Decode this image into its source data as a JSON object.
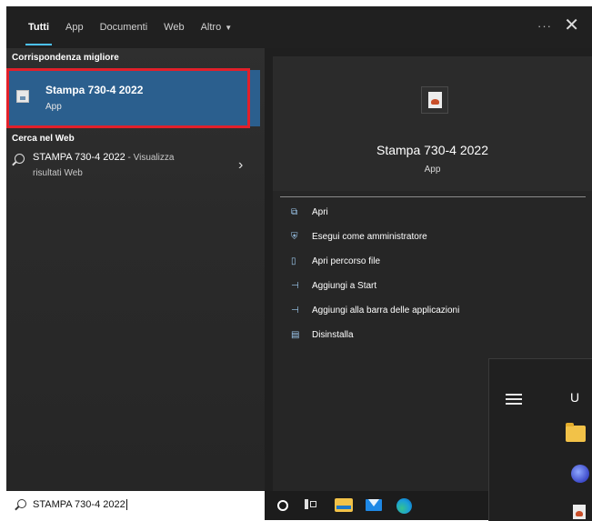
{
  "header": {
    "tabs": [
      {
        "label": "Tutti",
        "active": true
      },
      {
        "label": "App",
        "active": false
      },
      {
        "label": "Documenti",
        "active": false
      },
      {
        "label": "Web",
        "active": false
      },
      {
        "label": "Altro",
        "active": false
      }
    ],
    "more_label": "···",
    "close_label": "✕"
  },
  "results": {
    "best_match_heading": "Corrispondenza migliore",
    "best_match": {
      "title": "Stampa 730-4 2022",
      "subtitle": "App",
      "icon": "java-app-icon"
    },
    "web_heading": "Cerca nel Web",
    "web_item": {
      "query": "STAMPA 730-4 2022",
      "suffix": " - Visualizza",
      "line2": "risultati Web"
    }
  },
  "preview": {
    "title": "Stampa 730-4 2022",
    "subtitle": "App",
    "actions": [
      {
        "label": "Apri",
        "icon": "open-icon",
        "glyph": "⧉"
      },
      {
        "label": "Esegui come amministratore",
        "icon": "admin-shield-icon",
        "glyph": "⛨"
      },
      {
        "label": "Apri percorso file",
        "icon": "file-location-icon",
        "glyph": "▯"
      },
      {
        "label": "Aggiungi a Start",
        "icon": "pin-icon",
        "glyph": "⊣"
      },
      {
        "label": "Aggiungi alla barra delle applicazioni",
        "icon": "pin-taskbar-icon",
        "glyph": "⊣"
      },
      {
        "label": "Disinstalla",
        "icon": "trash-icon",
        "glyph": "▤"
      }
    ]
  },
  "start_menu": {
    "letter": "U"
  },
  "search": {
    "value": "STAMPA 730-4 2022"
  },
  "colors": {
    "accent": "#4cc2ff",
    "selection": "#2b5f8e",
    "highlight_outline": "#e2202a"
  }
}
